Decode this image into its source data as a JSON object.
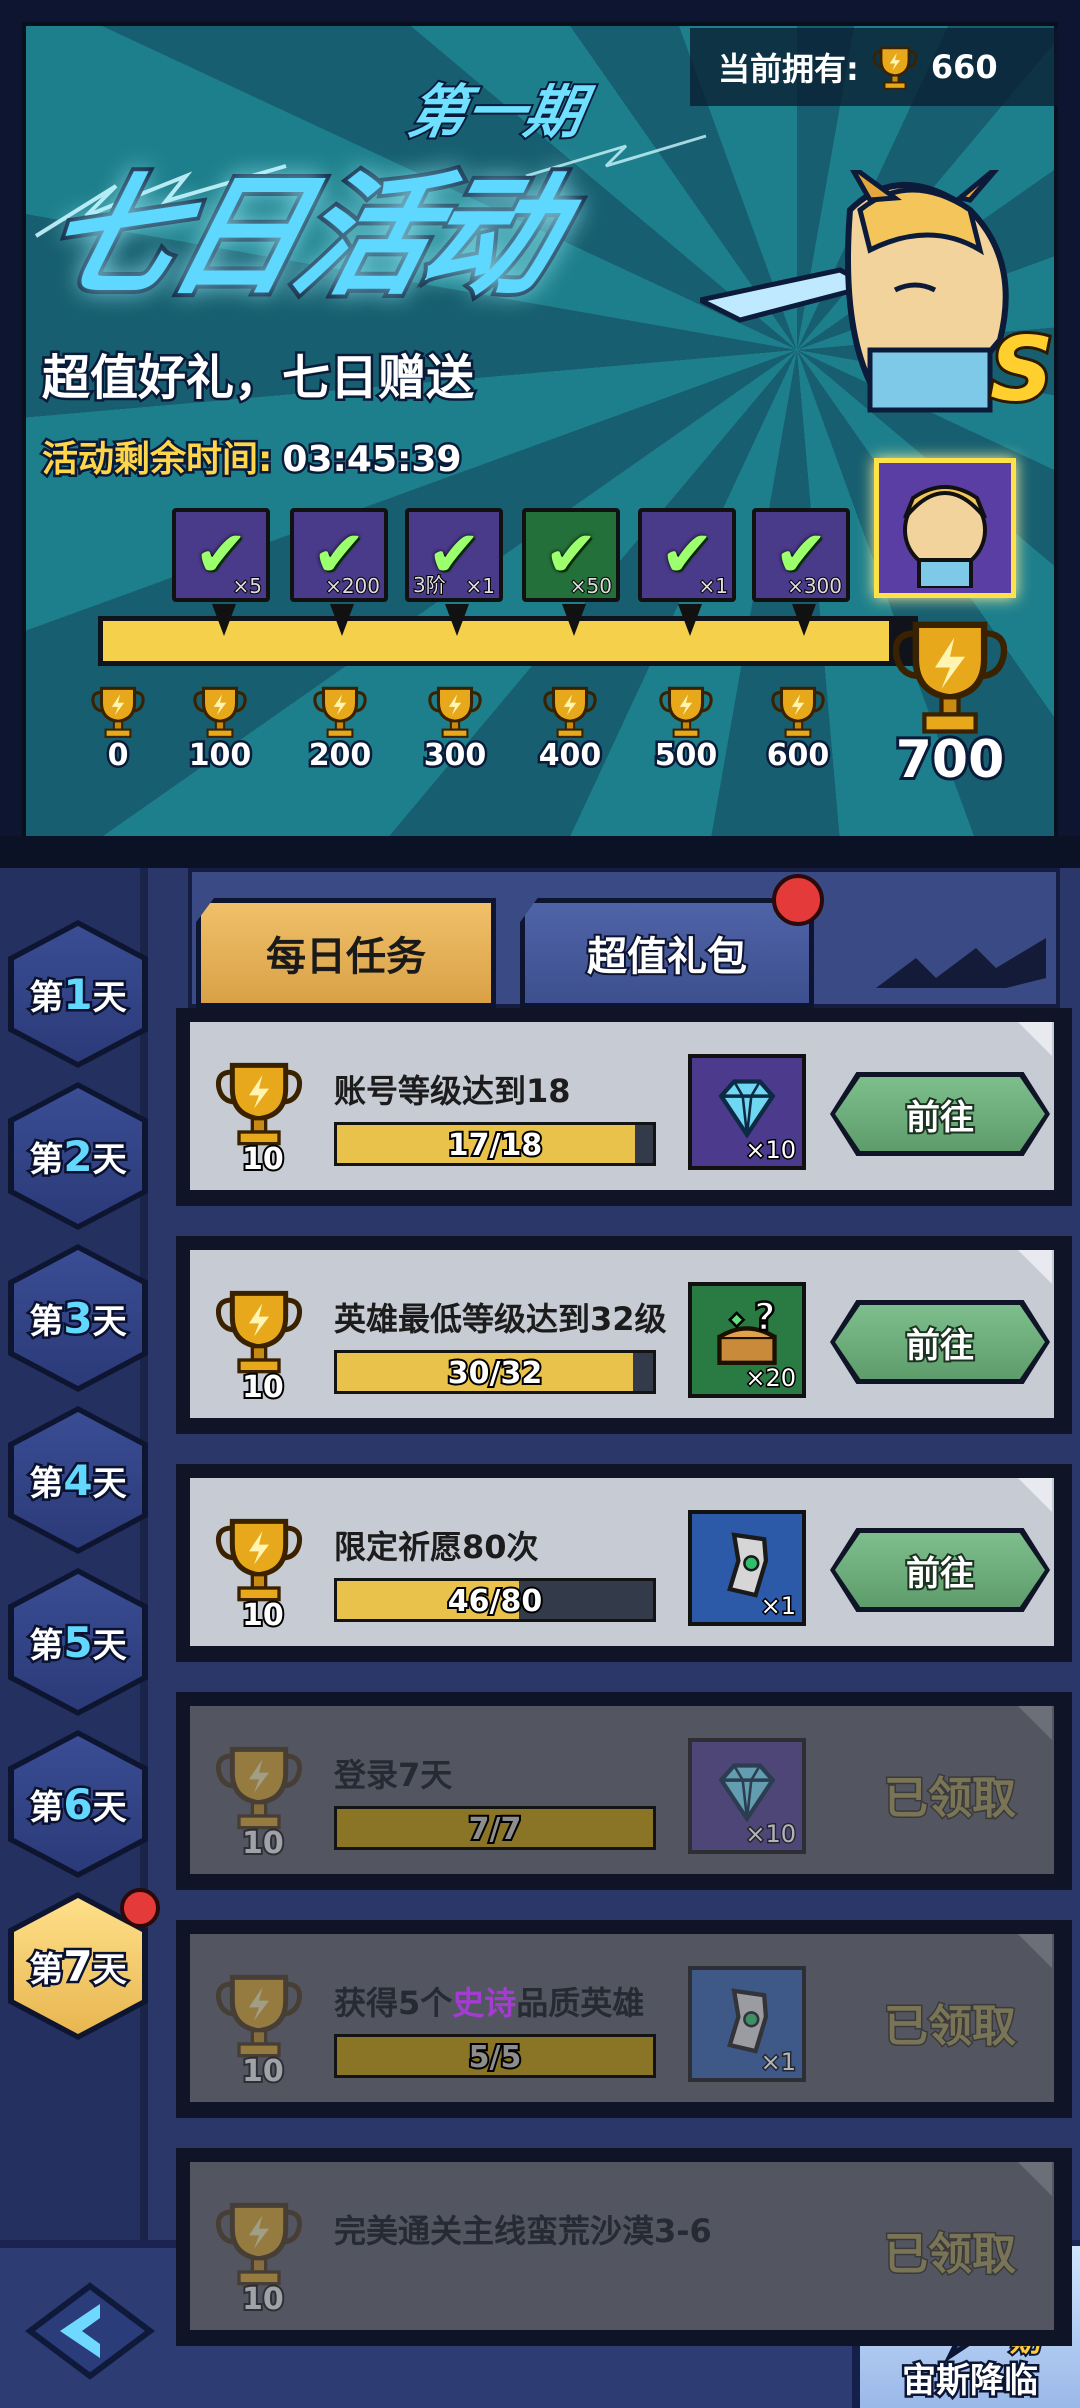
{
  "banner": {
    "currency_label": "当前拥有:",
    "currency_value": "660",
    "title_period": "第一期",
    "title_main": "七日活动",
    "subtitle": "超值好礼，七日赠送",
    "remaining_label": "活动剩余时间:",
    "remaining_value": "03:45:39",
    "hero_rank": "S",
    "progress_fraction": 0.97,
    "rewards": [
      {
        "qty": "×5",
        "color": "purple",
        "claimed": true
      },
      {
        "qty": "×200",
        "color": "purple",
        "claimed": true
      },
      {
        "qty": "×1",
        "qty_left": "3阶",
        "color": "purple",
        "claimed": true
      },
      {
        "qty": "×50",
        "color": "green",
        "claimed": true
      },
      {
        "qty": "×1",
        "color": "purple",
        "claimed": true
      },
      {
        "qty": "×300",
        "color": "purple",
        "claimed": true
      }
    ],
    "milestones": [
      "0",
      "100",
      "200",
      "300",
      "400",
      "500",
      "600"
    ],
    "final_milestone": "700"
  },
  "tabs": {
    "daily": "每日任务",
    "gift": "超值礼包"
  },
  "days": [
    {
      "prefix": "第",
      "num": "1",
      "suffix": "天"
    },
    {
      "prefix": "第",
      "num": "2",
      "suffix": "天"
    },
    {
      "prefix": "第",
      "num": "3",
      "suffix": "天"
    },
    {
      "prefix": "第",
      "num": "4",
      "suffix": "天"
    },
    {
      "prefix": "第",
      "num": "5",
      "suffix": "天"
    },
    {
      "prefix": "第",
      "num": "6",
      "suffix": "天"
    },
    {
      "prefix": "第",
      "num": "7",
      "suffix": "天"
    }
  ],
  "tasks": [
    {
      "points": "10",
      "title": "账号等级达到18",
      "progress": "17/18",
      "fraction": 0.944,
      "item": "diamond",
      "item_qty": "×10",
      "action": "前往",
      "done": false
    },
    {
      "points": "10",
      "title": "英雄最低等级达到32级",
      "progress": "30/32",
      "fraction": 0.9375,
      "item": "chest",
      "item_qty": "×20",
      "action": "前往",
      "done": false
    },
    {
      "points": "10",
      "title": "限定祈愿80次",
      "progress": "46/80",
      "fraction": 0.575,
      "item": "scroll",
      "item_qty": "×1",
      "action": "前往",
      "done": false
    },
    {
      "points": "10",
      "title": "登录7天",
      "progress": "7/7",
      "fraction": 1,
      "item": "diamond",
      "item_qty": "×10",
      "action": "已领取",
      "done": true
    },
    {
      "points": "10",
      "title_pre": "获得5个",
      "title_epic": "史诗",
      "title_post": "品质英雄",
      "progress": "5/5",
      "fraction": 1,
      "item": "scroll",
      "item_qty": "×1",
      "action": "已领取",
      "done": true
    },
    {
      "points": "10",
      "title": "完美通关主线蛮荒沙漠3-6",
      "action": "已领取",
      "done": true
    }
  ],
  "bottom": {
    "event_label": "宙斯降临",
    "event_sub": "一期"
  },
  "colors": {
    "gold": "#f5d04a",
    "go_button": "#6fae7c",
    "epic": "#a23dd0",
    "red_dot": "#e43a3a"
  }
}
